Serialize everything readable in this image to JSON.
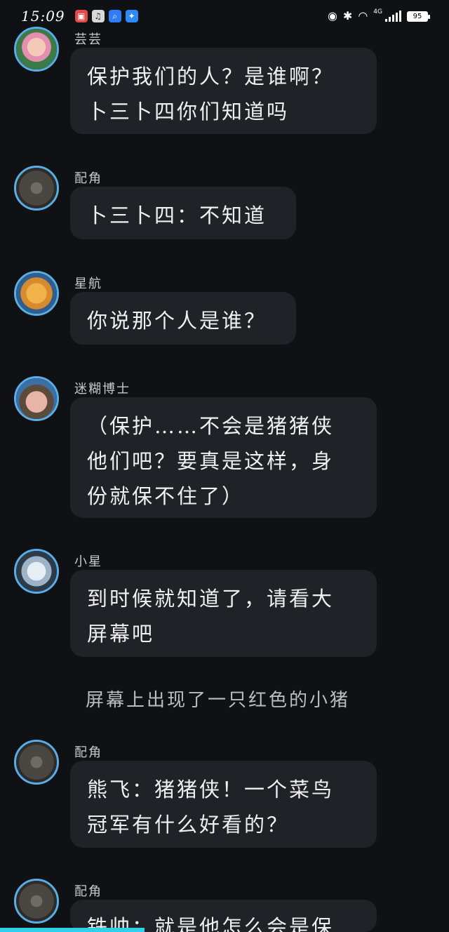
{
  "status_bar": {
    "time": "15:09",
    "network": "4G",
    "battery": "95"
  },
  "messages": [
    {
      "sender": "芸芸",
      "text": "保护我们的人？是谁啊？\n卜三卜四你们知道吗",
      "avatar_icon": "girl-avatar-icon"
    },
    {
      "sender": "配角",
      "text": "卜三卜四：不知道",
      "avatar_icon": "gray-texture-avatar-icon"
    },
    {
      "sender": "星航",
      "text": "你说那个人是谁？",
      "avatar_icon": "tiger-avatar-icon"
    },
    {
      "sender": "迷糊博士",
      "text": "（保护……不会是猪猪侠\n他们吧？要真是这样，身\n份就保不住了）",
      "avatar_icon": "pig-doctor-avatar-icon"
    },
    {
      "sender": "小星",
      "text": "到时候就知道了，请看大\n屏幕吧",
      "avatar_icon": "white-hair-avatar-icon"
    },
    {
      "sender": "配角",
      "text": "熊飞：猪猪侠！一个菜鸟\n冠军有什么好看的？",
      "avatar_icon": "gray-texture-avatar-icon"
    },
    {
      "sender": "配角",
      "text": "铁帅：就是他怎么会是保",
      "avatar_icon": "gray-texture-avatar-icon"
    }
  ],
  "narration": "屏幕上出现了一只红色的小猪",
  "colors": {
    "background": "#0f1114",
    "bubble": "#1f2226",
    "avatar_ring": "#5aaee6",
    "bottom_indicator": "#2fd0e8"
  }
}
